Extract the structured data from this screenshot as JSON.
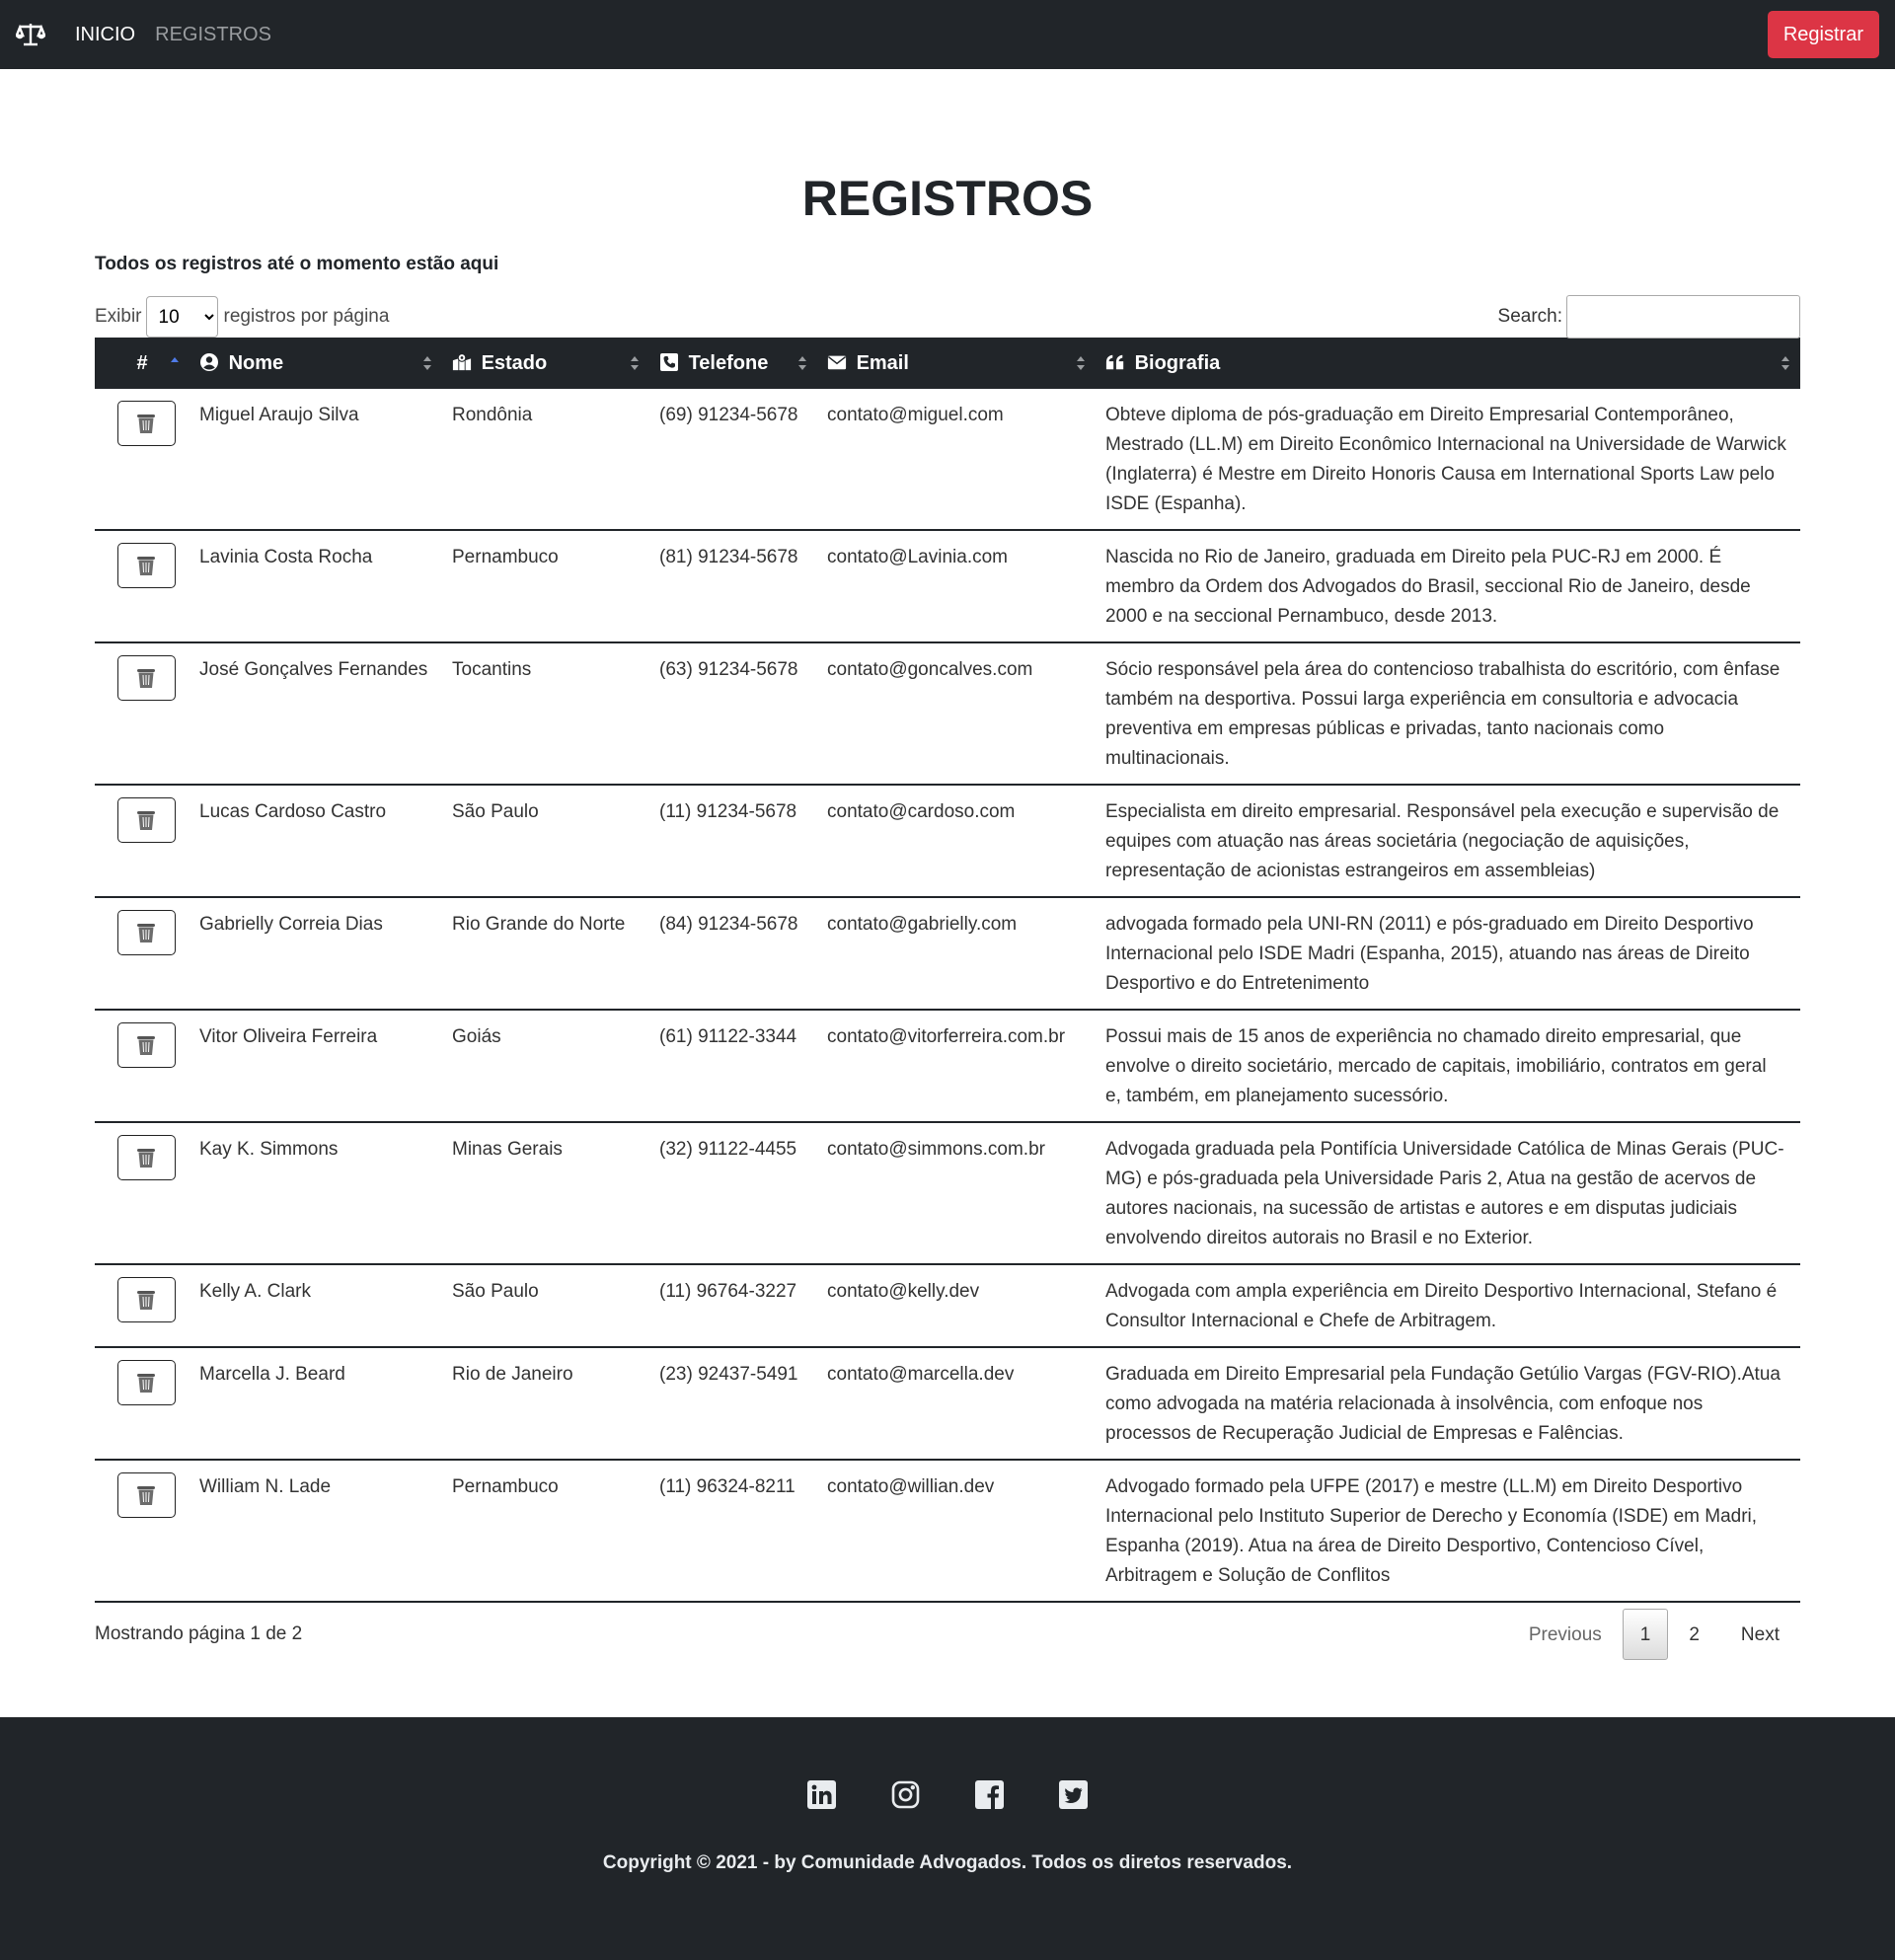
{
  "nav": {
    "logo_icon": "scale-balance-icon",
    "links": [
      {
        "label": "INICIO"
      },
      {
        "label": "REGISTROS"
      }
    ],
    "register_button": "Registrar"
  },
  "page": {
    "title": "REGISTROS",
    "subtitle": "Todos os registros até o momento estão aqui"
  },
  "controls": {
    "length_prefix": "Exibir",
    "length_value": "10",
    "length_suffix": "registros por página",
    "search_label": "Search:",
    "search_value": ""
  },
  "table": {
    "headers": {
      "id": "#",
      "nome": "Nome",
      "estado": "Estado",
      "telefone": "Telefone",
      "email": "Email",
      "biografia": "Biografia"
    },
    "rows": [
      {
        "nome": "Miguel Araujo Silva",
        "estado": "Rondônia",
        "telefone": "(69) 91234-5678",
        "email": "contato@miguel.com",
        "bio": "Obteve diploma de pós-graduação em Direito Empresarial Contemporâneo, Mestrado (LL.M) em Direito Econômico Internacional na Universidade de Warwick (Inglaterra) é Mestre em Direito Honoris Causa em International Sports Law pelo ISDE (Espanha)."
      },
      {
        "nome": "Lavinia Costa Rocha",
        "estado": "Pernambuco",
        "telefone": "(81) 91234-5678",
        "email": "contato@Lavinia.com",
        "bio": "Nascida no Rio de Janeiro, graduada em Direito pela PUC-RJ em 2000. É membro da Ordem dos Advogados do Brasil, seccional Rio de Janeiro, desde 2000 e na seccional Pernambuco, desde 2013."
      },
      {
        "nome": "José Gonçalves Fernandes",
        "estado": "Tocantins",
        "telefone": "(63) 91234-5678",
        "email": "contato@goncalves.com",
        "bio": "Sócio responsável pela área do contencioso trabalhista do escritório, com ênfase também na desportiva. Possui larga experiência em consultoria e advocacia preventiva em empresas públicas e privadas, tanto nacionais como multinacionais."
      },
      {
        "nome": "Lucas Cardoso Castro",
        "estado": "São Paulo",
        "telefone": "(11) 91234-5678",
        "email": "contato@cardoso.com",
        "bio": "Especialista em direito empresarial. Responsável pela execução e supervisão de equipes com atuação nas áreas societária (negociação de aquisições, representação de acionistas estrangeiros em assembleias)"
      },
      {
        "nome": "Gabrielly Correia Dias",
        "estado": "Rio Grande do Norte",
        "telefone": "(84) 91234-5678",
        "email": "contato@gabrielly.com",
        "bio": "advogada formado pela UNI-RN (2011) e pós-graduado em Direito Desportivo Internacional pelo ISDE Madri (Espanha, 2015), atuando nas áreas de Direito Desportivo e do Entretenimento"
      },
      {
        "nome": "Vitor Oliveira Ferreira",
        "estado": "Goiás",
        "telefone": "(61) 91122-3344",
        "email": "contato@vitorferreira.com.br",
        "bio": "Possui mais de 15 anos de experiência no chamado direito empresarial, que envolve o direito societário, mercado de capitais, imobiliário, contratos em geral e, também, em planejamento sucessório."
      },
      {
        "nome": "Kay K. Simmons",
        "estado": "Minas Gerais",
        "telefone": "(32) 91122-4455",
        "email": "contato@simmons.com.br",
        "bio": "Advogada graduada pela Pontifícia Universidade Católica de Minas Gerais (PUC-MG) e pós-graduada pela Universidade Paris 2, Atua na gestão de acervos de autores nacionais, na sucessão de artistas e autores e em disputas judiciais envolvendo direitos autorais no Brasil e no Exterior."
      },
      {
        "nome": "Kelly A. Clark",
        "estado": "São Paulo",
        "telefone": "(11) 96764-3227",
        "email": "contato@kelly.dev",
        "bio": "Advogada com ampla experiência em Direito Desportivo Internacional, Stefano é Consultor Internacional e Chefe de Arbitragem."
      },
      {
        "nome": "Marcella J. Beard",
        "estado": "Rio de Janeiro",
        "telefone": "(23) 92437-5491",
        "email": "contato@marcella.dev",
        "bio": "Graduada em Direito Empresarial pela Fundação Getúlio Vargas (FGV-RIO).Atua como advogada na matéria relacionada à insolvência, com enfoque nos processos de Recuperação Judicial de Empresas e Falências."
      },
      {
        "nome": "William N. Lade",
        "estado": "Pernambuco",
        "telefone": "(11) 96324-8211",
        "email": "contato@willian.dev",
        "bio": "Advogado formado pela UFPE (2017) e mestre (LL.M) em Direito Desportivo Internacional pelo Instituto Superior de Derecho y Economía (ISDE) em Madri, Espanha (2019). Atua na área de Direito Desportivo, Contencioso Cível, Arbitragem e Solução de Conflitos"
      }
    ]
  },
  "pagination": {
    "info": "Mostrando página 1 de 2",
    "previous": "Previous",
    "pages": [
      "1",
      "2"
    ],
    "next": "Next"
  },
  "footer": {
    "social_icons": [
      "linkedin-icon",
      "instagram-icon",
      "facebook-icon",
      "twitter-icon"
    ],
    "copyright": "Copyright © 2021 - by Comunidade Advogados. Todos os diretos reservados."
  }
}
